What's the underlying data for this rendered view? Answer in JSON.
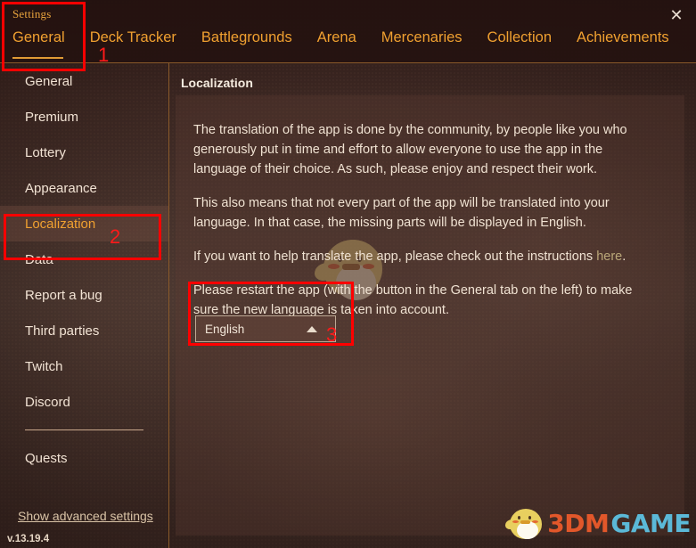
{
  "header": {
    "settings_label": "Settings",
    "close_icon": "close-icon",
    "tabs": [
      {
        "label": "General",
        "active": true
      },
      {
        "label": "Deck Tracker",
        "active": false
      },
      {
        "label": "Battlegrounds",
        "active": false
      },
      {
        "label": "Arena",
        "active": false
      },
      {
        "label": "Mercenaries",
        "active": false
      },
      {
        "label": "Collection",
        "active": false
      },
      {
        "label": "Achievements",
        "active": false
      }
    ]
  },
  "sidebar": {
    "items": [
      {
        "label": "General",
        "selected": false
      },
      {
        "label": "Premium",
        "selected": false
      },
      {
        "label": "Lottery",
        "selected": false
      },
      {
        "label": "Appearance",
        "selected": false
      },
      {
        "label": "Localization",
        "selected": true
      },
      {
        "label": "Data",
        "selected": false
      },
      {
        "label": "Report a bug",
        "selected": false
      },
      {
        "label": "Third parties",
        "selected": false
      },
      {
        "label": "Twitch",
        "selected": false
      },
      {
        "label": "Discord",
        "selected": false
      }
    ],
    "divider_after_index": 9,
    "items_after_divider": [
      {
        "label": "Quests",
        "selected": false
      }
    ],
    "advanced_settings_link": "Show advanced settings",
    "version": "v.13.19.4"
  },
  "main": {
    "title": "Localization",
    "paragraph_1": "The translation of the app is done by the community, by people like you who generously put in time and effort to allow everyone to use the app in the language of their choice. As such, please enjoy and respect their work.",
    "paragraph_2": "This also means that not every part of the app will be translated into your language. In that case, the missing parts will be displayed in English.",
    "paragraph_3_before_link": "If you want to help translate the app, please check out the instructions ",
    "paragraph_3_link": "here",
    "paragraph_3_after_link": ".",
    "paragraph_4": "Please restart the app (with the button in the General tab on the left) to make sure the new language is taken into account.",
    "language_select": {
      "value": "English",
      "caret_icon": "caret-up-icon"
    }
  },
  "watermark": {
    "text_primary": "3DM",
    "text_secondary": "GAME",
    "mascot": "chick-icon"
  },
  "annotations": [
    {
      "number": "1",
      "target": "general-tab"
    },
    {
      "number": "2",
      "target": "sidebar-item-localization"
    },
    {
      "number": "3",
      "target": "language-select"
    }
  ],
  "colors": {
    "accent_orange": "#f0a030",
    "border_orange": "#8a5a2a",
    "annotation_red": "#ff0000",
    "link_olive": "#b9a678",
    "watermark_3dm": "#e2572a",
    "watermark_game": "#5bb9d8",
    "background_brown": "#4a3730"
  }
}
